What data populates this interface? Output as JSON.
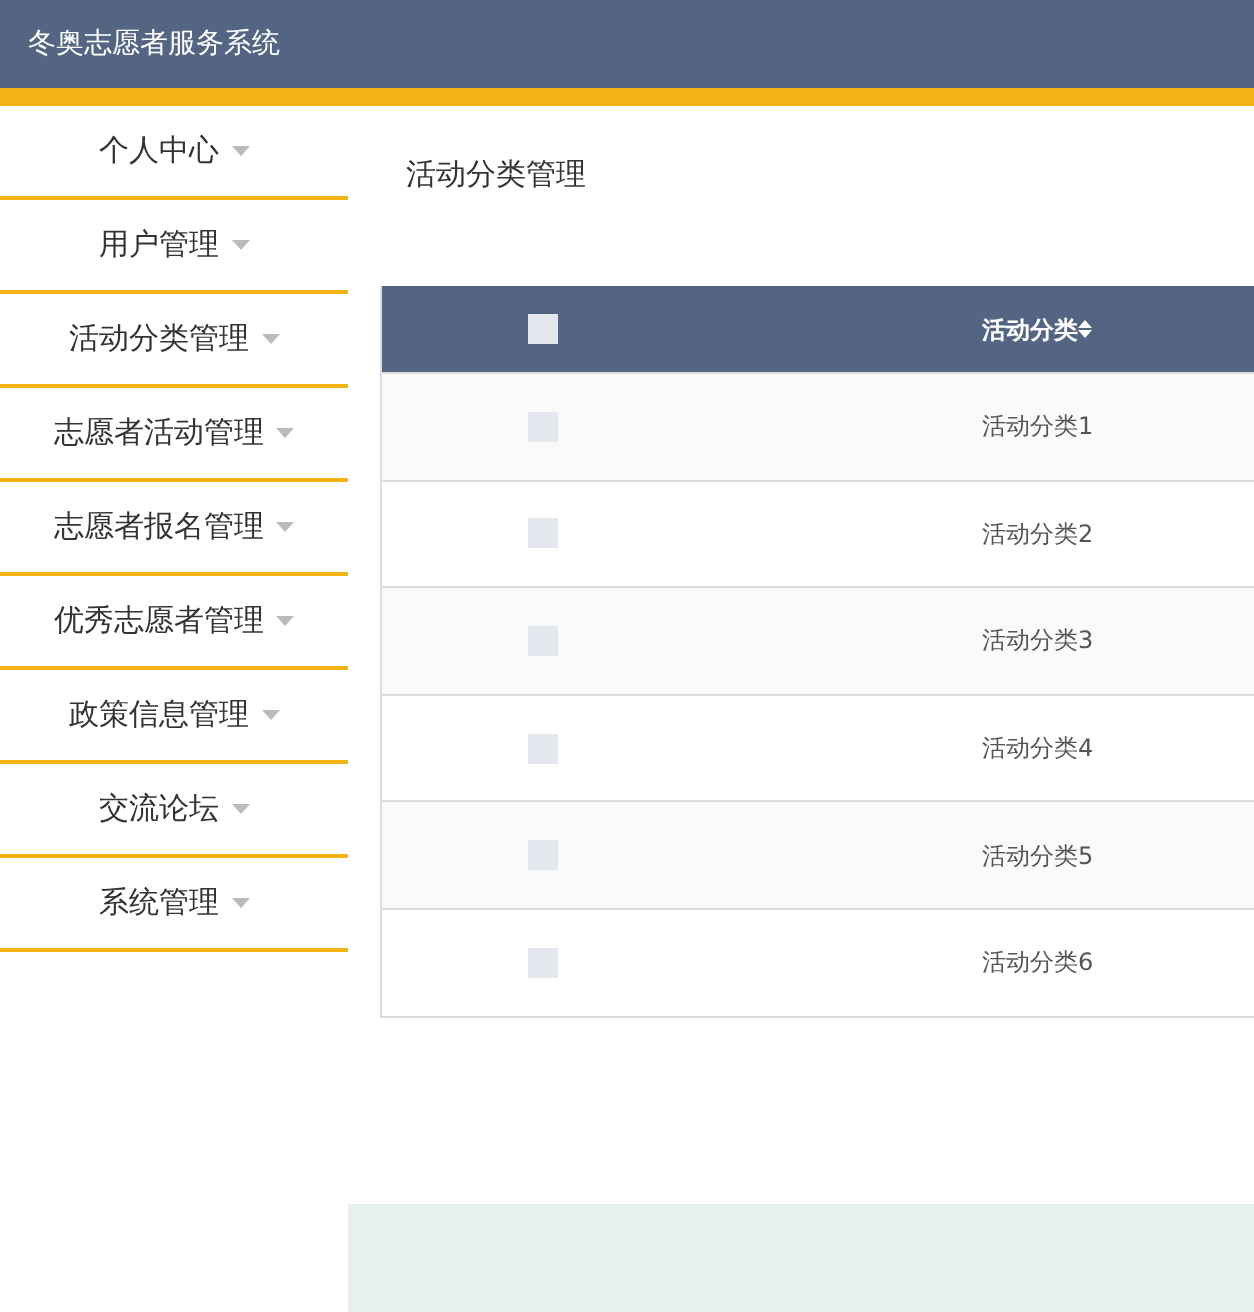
{
  "header": {
    "title": "冬奥志愿者服务系统"
  },
  "sidebar": {
    "items": [
      {
        "label": "个人中心",
        "selected": false
      },
      {
        "label": "用户管理",
        "selected": false
      },
      {
        "label": "活动分类管理",
        "selected": false
      },
      {
        "label": "志愿者活动管理",
        "selected": false
      },
      {
        "label": "志愿者报名管理",
        "selected": false
      },
      {
        "label": "优秀志愿者管理",
        "selected": false
      },
      {
        "label": "政策信息管理",
        "selected": false
      },
      {
        "label": "交流论坛",
        "selected": false
      },
      {
        "label": "系统管理",
        "selected": false
      }
    ]
  },
  "page_title": "活动分类管理",
  "table": {
    "select_all": {
      "checked": false
    },
    "columns": [
      "活动分类"
    ],
    "rows": [
      {
        "checked": false,
        "cells": [
          "活动分类1"
        ]
      },
      {
        "checked": false,
        "cells": [
          "活动分类2"
        ]
      },
      {
        "checked": false,
        "cells": [
          "活动分类3"
        ]
      },
      {
        "checked": false,
        "cells": [
          "活动分类4"
        ]
      },
      {
        "checked": false,
        "cells": [
          "活动分类5"
        ]
      },
      {
        "checked": false,
        "cells": [
          "活动分类6"
        ]
      }
    ]
  }
}
